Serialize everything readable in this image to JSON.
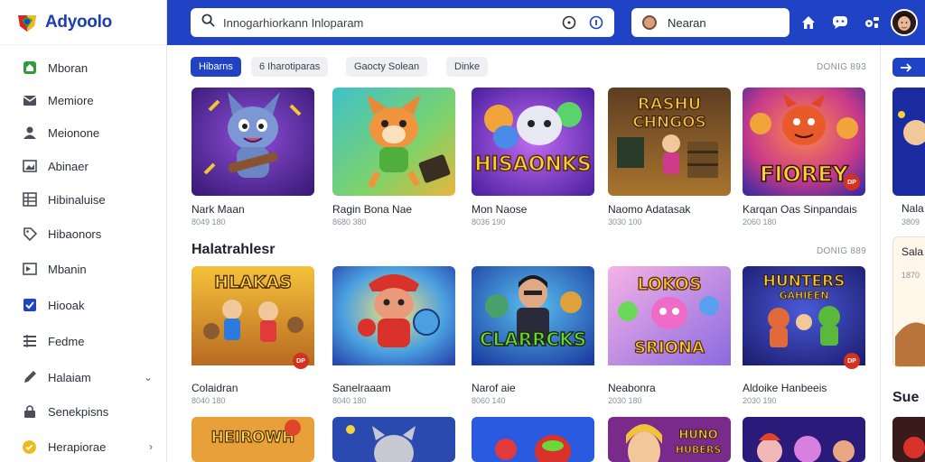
{
  "app": {
    "name": "Adyoolo"
  },
  "sidebar": {
    "items": [
      {
        "label": "Mboran",
        "icon": "home-icon",
        "active": true
      },
      {
        "label": "Memiore",
        "icon": "mail-icon"
      },
      {
        "label": "Meionone",
        "icon": "user-icon"
      },
      {
        "label": "Abinaer",
        "icon": "image-icon"
      },
      {
        "label": "Hibinaluise",
        "icon": "grid-icon"
      },
      {
        "label": "Hibaonors",
        "icon": "tag-icon"
      },
      {
        "label": "Mbanin",
        "icon": "flag-icon"
      },
      {
        "label": "Hiooak",
        "icon": "check-icon"
      },
      {
        "label": "Fedme",
        "icon": "list-icon"
      },
      {
        "label": "Halaiam",
        "icon": "pencil-icon",
        "chevron": "⌄"
      },
      {
        "label": "Senekpisns",
        "icon": "lock-icon"
      },
      {
        "label": "Herapiorae",
        "icon": "coin-icon",
        "chevron": "›"
      }
    ]
  },
  "topbar": {
    "search_text": "Innogarhiorkann Inloparam",
    "user_name": "Nearan"
  },
  "filters": {
    "chips": [
      {
        "label": "Hibarns",
        "active": true
      },
      {
        "label": "6 Iharotiparas",
        "active": false
      },
      {
        "label": "Gaocty  Solean",
        "active": false
      },
      {
        "label": "Dinke",
        "active": false
      }
    ],
    "meta": "DONIG 893"
  },
  "section2": {
    "title": "Halatrahlesr",
    "meta": "DONIG 889"
  },
  "cards_row1": [
    {
      "title": "Nark Maan",
      "sub": "8049 180",
      "theme": "purple-cat"
    },
    {
      "title": "Ragin Bona Nae",
      "sub": "8680 380",
      "theme": "green-fox"
    },
    {
      "title": "Mon Naose",
      "sub": "8036 190",
      "theme": "hisaonks"
    },
    {
      "title": "Naomo Adatasak",
      "sub": "3030 100",
      "theme": "rashu"
    },
    {
      "title": "Karqan Oas Sinpandais",
      "sub": "2060 180",
      "theme": "fiorey",
      "badge": "DP"
    }
  ],
  "cards_row2": [
    {
      "title": "Colaidran",
      "sub": "8040 180",
      "theme": "hlakas",
      "badge": "DP"
    },
    {
      "title": "Sanelraaam",
      "sub": "8040 180",
      "theme": "red-cap"
    },
    {
      "title": "Narof aie",
      "sub": "8060 140",
      "theme": "clarrcks"
    },
    {
      "title": "Neabonra",
      "sub": "2030 180",
      "theme": "lokos"
    },
    {
      "title": "Aldoike Hanbeeis",
      "sub": "2030 190",
      "theme": "hunters",
      "badge": "DP"
    }
  ],
  "cards_row3": [
    {
      "title": "",
      "sub": "",
      "theme": "heirowh"
    },
    {
      "title": "",
      "sub": "",
      "theme": "grey-cat"
    },
    {
      "title": "",
      "sub": "",
      "theme": "blue-bird"
    },
    {
      "title": "",
      "sub": "",
      "theme": "blond"
    },
    {
      "title": "",
      "sub": "",
      "theme": "night"
    }
  ],
  "right_column": {
    "card1_title": "Nala",
    "card1_sub": "3809",
    "card2_title": "Sala",
    "card2_sub": "1870",
    "section_title": "Sue"
  },
  "colors": {
    "accent": "#1f43c4",
    "badge": "#d4321e"
  }
}
